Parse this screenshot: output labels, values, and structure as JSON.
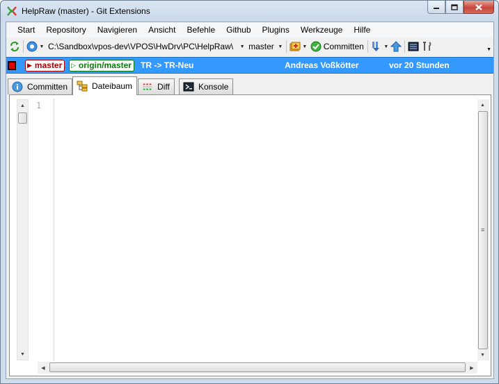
{
  "window": {
    "title": "HelpRaw (master) - Git Extensions"
  },
  "menu": [
    "Start",
    "Repository",
    "Navigieren",
    "Ansicht",
    "Befehle",
    "Github",
    "Plugins",
    "Werkzeuge",
    "Hilfe"
  ],
  "toolbar": {
    "path": "C:\\Sandbox\\vpos-dev\\VPOS\\HwDrv\\PC\\HelpRaw\\",
    "branch": "master",
    "commit_label": "Committen"
  },
  "infobar": {
    "local_branch": "master",
    "remote_branch": "origin/master",
    "message": "TR -> TR-Neu",
    "author": "Andreas Voßkötter",
    "date": "vor 20 Stunden"
  },
  "tabs": [
    {
      "label": "Committen",
      "active": false,
      "icon": "info-icon"
    },
    {
      "label": "Dateibaum",
      "active": true,
      "icon": "file-tree-icon"
    },
    {
      "label": "Diff",
      "active": false,
      "icon": "diff-icon"
    },
    {
      "label": "Konsole",
      "active": false,
      "icon": "console-icon"
    }
  ],
  "editor": {
    "line_number": "1"
  },
  "colors": {
    "infobar_bg": "#3399ff",
    "local_branch": "#b00000",
    "remote_branch": "#0a7a0a"
  }
}
